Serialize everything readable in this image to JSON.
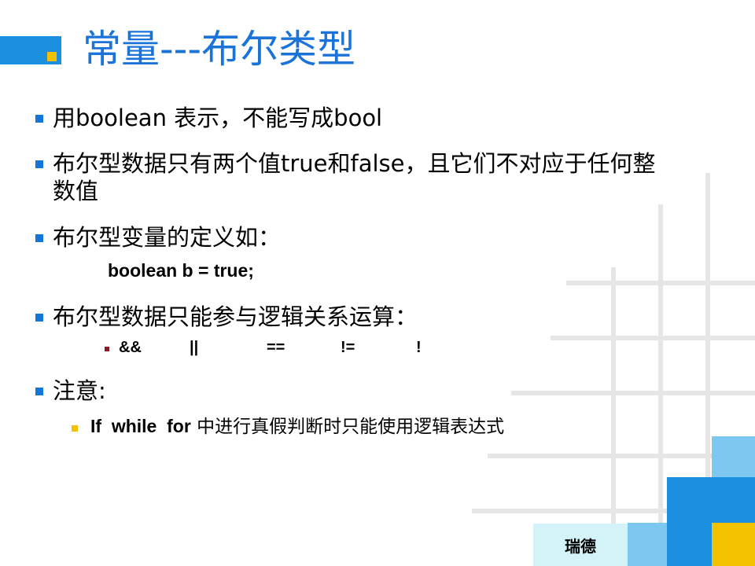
{
  "title": "常量---布尔类型",
  "bullets": [
    "用boolean 表示，不能写成bool",
    "布尔型数据只有两个值true和false，且它们不对应于任何整",
    "数值",
    "布尔型变量的定义如：",
    "布尔型数据只能参与逻辑关系运算：",
    "注意:"
  ],
  "code_line": "boolean b = true;",
  "operators": [
    "&&",
    "||",
    "==",
    "!=",
    "!"
  ],
  "note": {
    "keywords": "If  while  for",
    "text": "中进行真假判断时只能使用逻辑表达式"
  },
  "footer_label": "瑞德",
  "colors": {
    "title": "#1a73d9",
    "bullet_blue": "#1476d9",
    "accent_yellow": "#f2c200",
    "accent_light_blue": "#7cc8f0",
    "operator_bullet": "#8b1a2b"
  }
}
